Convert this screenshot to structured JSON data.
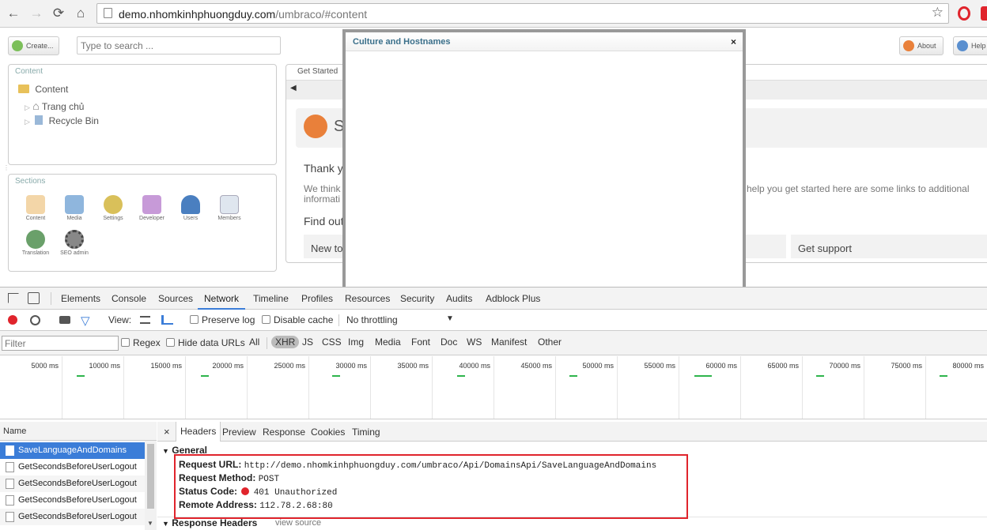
{
  "browser": {
    "url_host": "demo.nhomkinhphuongduy.com",
    "url_path": "/umbraco/#content",
    "icons": [
      "back-icon",
      "forward-icon",
      "reload-icon",
      "home-icon",
      "info-icon",
      "star-icon",
      "opera-icon",
      "extension-icon"
    ]
  },
  "umbraco": {
    "create_label": "Create...",
    "search_placeholder": "Type to search ...",
    "about_label": "About",
    "help_label": "Help",
    "content_panel_title": "Content",
    "tree": [
      "Content",
      "Trang chủ",
      "Recycle Bin"
    ],
    "sections_title": "Sections",
    "sections": [
      "Content",
      "Media",
      "Settings",
      "Developer",
      "Users",
      "Members",
      "Translation",
      "SEO admin"
    ],
    "dashboard_tab": "Get Started",
    "dashboard_texts": {
      "logo_text": "S",
      "thank": "Thank y",
      "we_think": "We think",
      "information": "informati",
      "help_text": "help you get started here are some links to additional",
      "find_out": "Find out",
      "new_to": "New to",
      "get_support": "Get support"
    },
    "accent": "#e9803a"
  },
  "modal": {
    "title": "Culture and Hostnames",
    "close": "×"
  },
  "devtools": {
    "tabs": [
      "Elements",
      "Console",
      "Sources",
      "Network",
      "Timeline",
      "Profiles",
      "Resources",
      "Security",
      "Audits",
      "Adblock Plus"
    ],
    "active_tab": "Network",
    "toolbar": {
      "view_label": "View:",
      "preserve_log": "Preserve log",
      "disable_cache": "Disable cache",
      "throttling": "No throttling"
    },
    "filter": {
      "placeholder": "Filter",
      "regex": "Regex",
      "hide_data_urls": "Hide data URLs",
      "types": [
        "All",
        "XHR",
        "JS",
        "CSS",
        "Img",
        "Media",
        "Font",
        "Doc",
        "WS",
        "Manifest",
        "Other"
      ],
      "active_type": "XHR"
    },
    "timeline_ticks": [
      "5000 ms",
      "10000 ms",
      "15000 ms",
      "20000 ms",
      "25000 ms",
      "30000 ms",
      "35000 ms",
      "40000 ms",
      "45000 ms",
      "50000 ms",
      "55000 ms",
      "60000 ms",
      "65000 ms",
      "70000 ms",
      "75000 ms",
      "80000 ms"
    ],
    "name_header": "Name",
    "requests": [
      "SaveLanguageAndDomains",
      "GetSecondsBeforeUserLogout",
      "GetSecondsBeforeUserLogout",
      "GetSecondsBeforeUserLogout",
      "GetSecondsBeforeUserLogout"
    ],
    "detail_tabs": [
      "Headers",
      "Preview",
      "Response",
      "Cookies",
      "Timing"
    ],
    "active_detail_tab": "Headers",
    "close_icon": "×",
    "general": {
      "title": "General",
      "request_url_key": "Request URL:",
      "request_url": "http://demo.nhomkinhphuongduy.com/umbraco/Api/DomainsApi/SaveLanguageAndDomains",
      "request_method_key": "Request Method:",
      "request_method": "POST",
      "status_code_key": "Status Code:",
      "status_code": "401 Unauthorized",
      "status_color": "#e0242c",
      "remote_address_key": "Remote Address:",
      "remote_address": "112.78.2.68:80"
    },
    "response_headers": {
      "title": "Response Headers",
      "view_source": "view source"
    },
    "highlight_color": "#e0242c"
  }
}
